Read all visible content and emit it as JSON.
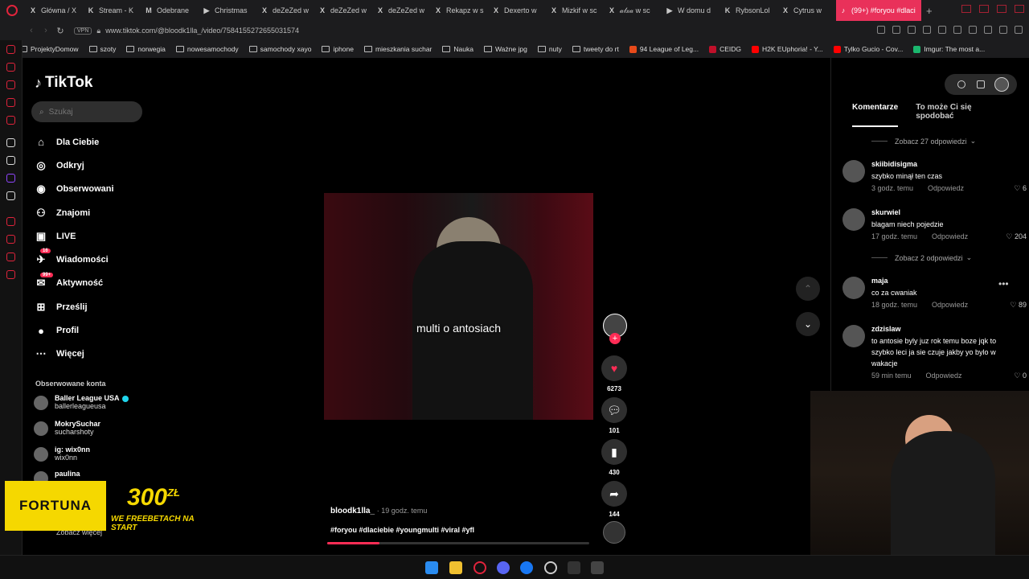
{
  "tabs": [
    {
      "icon": "X",
      "label": "Główna / X"
    },
    {
      "icon": "K",
      "label": "Stream - K"
    },
    {
      "icon": "M",
      "label": "Odebrane"
    },
    {
      "icon": "▶",
      "label": "Christmas"
    },
    {
      "icon": "X",
      "label": "deZeZed w"
    },
    {
      "icon": "X",
      "label": "deZeZed w"
    },
    {
      "icon": "X",
      "label": "deZeZed w"
    },
    {
      "icon": "X",
      "label": "Rekapz w s"
    },
    {
      "icon": "X",
      "label": "Dexerto w"
    },
    {
      "icon": "X",
      "label": "Mizkif w sc"
    },
    {
      "icon": "X",
      "label": "𝒶𝓁𝓍𝒶 w sc"
    },
    {
      "icon": "▶",
      "label": "W domu d"
    },
    {
      "icon": "K",
      "label": "RybsonLol"
    },
    {
      "icon": "X",
      "label": "Cytrus w"
    }
  ],
  "active_tab": {
    "icon": "♪",
    "label": "(99+) #foryou #dlaci"
  },
  "address": {
    "vpn": "VPN",
    "url": "www.tiktok.com/@bloodk1lla_/video/7584155272655031574"
  },
  "bookmarks": [
    {
      "label": "ProjektyDomow",
      "type": "folder"
    },
    {
      "label": "szoty",
      "type": "folder"
    },
    {
      "label": "norwegia",
      "type": "folder"
    },
    {
      "label": "nowesamochody",
      "type": "folder"
    },
    {
      "label": "samochody xayo",
      "type": "folder"
    },
    {
      "label": "iphone",
      "type": "folder"
    },
    {
      "label": "mieszkania suchar",
      "type": "folder"
    },
    {
      "label": "Nauka",
      "type": "folder"
    },
    {
      "label": "Ważne jpg",
      "type": "folder"
    },
    {
      "label": "nuty",
      "type": "folder"
    },
    {
      "label": "tweety do rt",
      "type": "folder"
    },
    {
      "label": "94 League of Leg...",
      "type": "site",
      "color": "#e84a1a"
    },
    {
      "label": "CEIDG",
      "type": "site",
      "color": "#c0102a"
    },
    {
      "label": "H2K EUphoria! - Y...",
      "type": "site",
      "color": "#ff0000"
    },
    {
      "label": "Tylko Gucio - Cov...",
      "type": "site",
      "color": "#ff0000"
    },
    {
      "label": "Imgur: The most a...",
      "type": "site",
      "color": "#1bb76e"
    }
  ],
  "tiktok": {
    "logo": "TikTok",
    "search_placeholder": "Szukaj",
    "nav": [
      {
        "icon": "⌂",
        "label": "Dla Ciebie"
      },
      {
        "icon": "◎",
        "label": "Odkryj"
      },
      {
        "icon": "◉",
        "label": "Obserwowani"
      },
      {
        "icon": "⚇",
        "label": "Znajomi"
      },
      {
        "icon": "▣",
        "label": "LIVE"
      },
      {
        "icon": "✈",
        "label": "Wiadomości",
        "badge": "16"
      },
      {
        "icon": "✉",
        "label": "Aktywność",
        "badge": "99+"
      },
      {
        "icon": "⊞",
        "label": "Prześlij"
      },
      {
        "icon": "●",
        "label": "Profil"
      },
      {
        "icon": "⋯",
        "label": "Więcej"
      }
    ],
    "following_title": "Obserwowane konta",
    "accounts": [
      {
        "name": "Baller League USA",
        "handle": "ballerleagueusa",
        "verified": true
      },
      {
        "name": "MokrySuchar",
        "handle": "sucharshoty"
      },
      {
        "name": "ig: wix0nn",
        "handle": "wix0nn"
      },
      {
        "name": "paulina",
        "handle": ""
      }
    ],
    "see_more": "Zobacz więcej"
  },
  "video": {
    "overlay_text": "multi o antosiach",
    "author": "bloodk1lla_",
    "time": "· 19 godz. temu",
    "hashtags": "#foryou #dlaciebie #youngmulti #viral #yfl",
    "progress": 0.2
  },
  "actions": {
    "likes": "6273",
    "comments": "101",
    "saves": "430",
    "shares": "144"
  },
  "comments_panel": {
    "tab_comments": "Komentarze",
    "tab_related": "To może Ci się spodobać",
    "replies_1": "Zobacz 27 odpowiedzi",
    "replies_2": "Zobacz 2 odpowiedzi",
    "reply_label": "Odpowiedz",
    "comments": [
      {
        "name": "skiibidisigma",
        "text": "szybko minął ten czas",
        "time": "3 godz. temu",
        "likes": "6"
      },
      {
        "name": "skurwiel",
        "text": "blagam niech pojedzie",
        "time": "17 godz. temu",
        "likes": "204"
      },
      {
        "name": "maja",
        "text": "co za cwaniak",
        "time": "18 godz. temu",
        "likes": "89"
      },
      {
        "name": "zdzislaw",
        "text": "to antosie byly juz rok temu boze jqk to szybko leci ja sie czuje jakby yo bylo w wakacje",
        "time": "59 min temu",
        "likes": "0"
      }
    ]
  },
  "ad": {
    "brand": "FORTUNA",
    "amount": "300",
    "currency": "ZŁ",
    "promo": "WE FREEBETACH NA START"
  }
}
